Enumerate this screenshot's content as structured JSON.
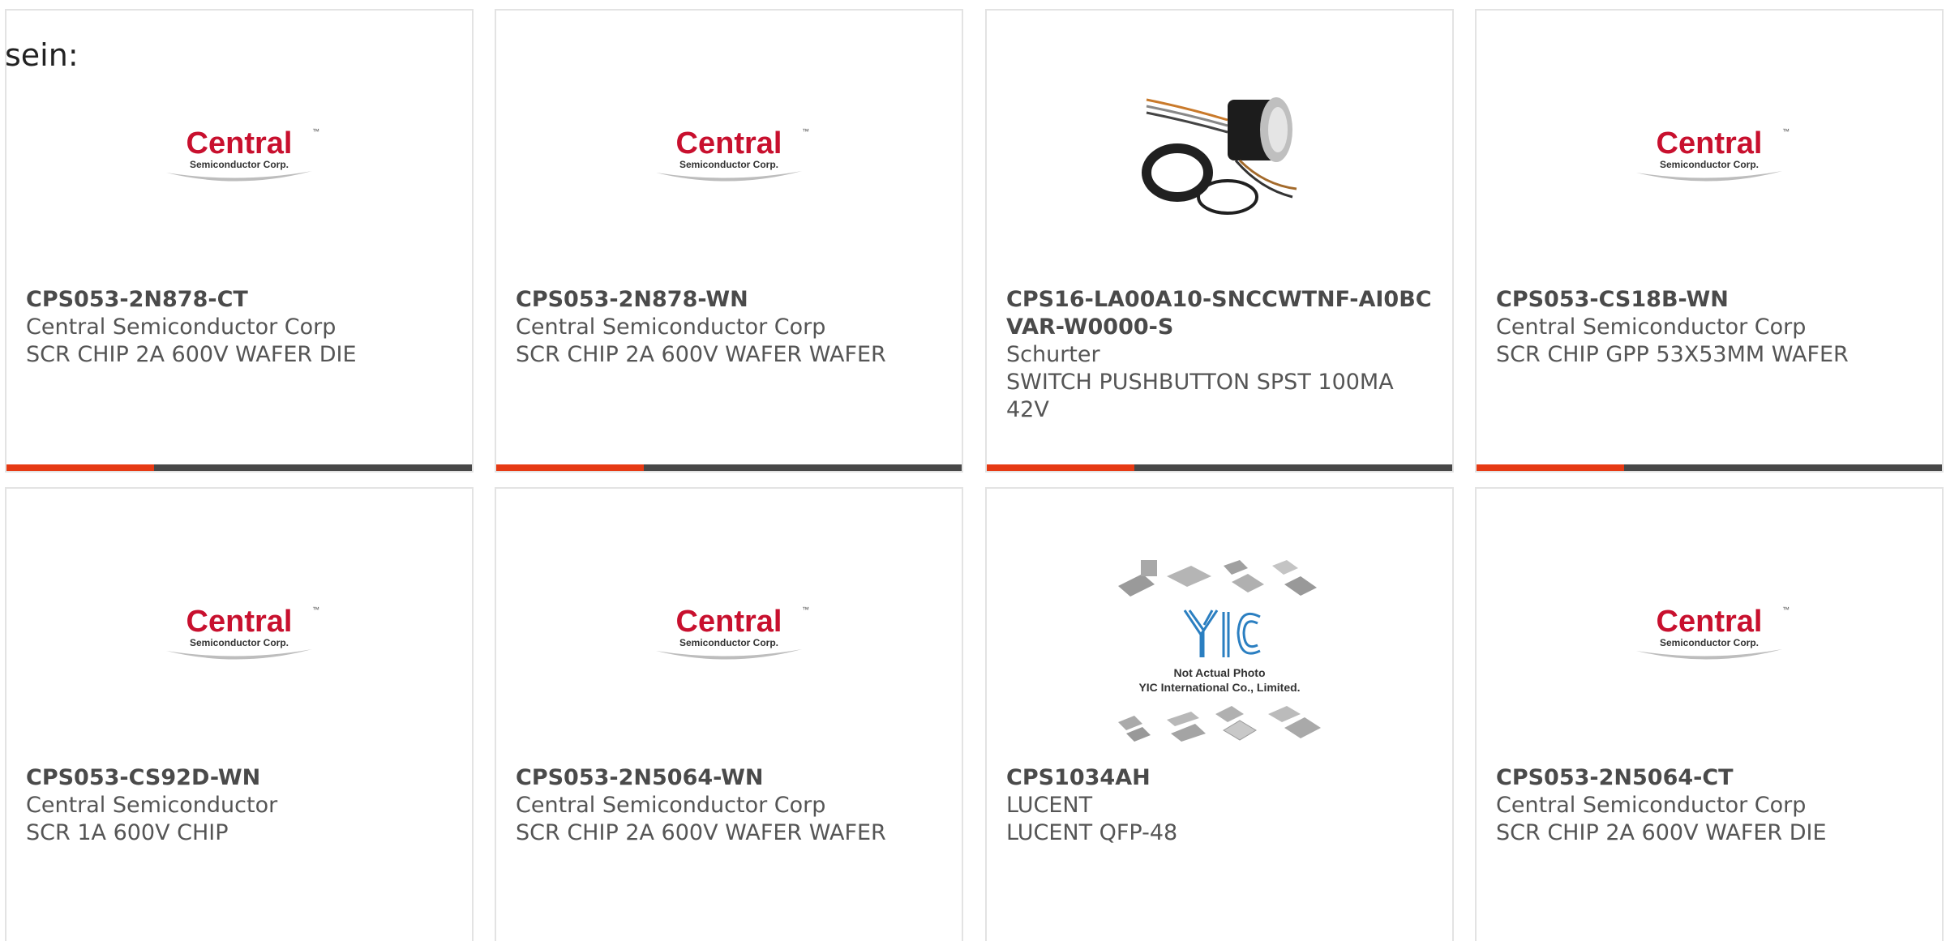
{
  "intro_text": "sein:",
  "colors": {
    "accent": "#e63a14",
    "bar_dark": "#474747",
    "logo_red": "#c8102e"
  },
  "products": [
    {
      "part_number": "CPS053-2N878-CT",
      "manufacturer": "Central Semiconductor Corp",
      "description": "SCR CHIP 2A 600V WAFER DIE",
      "image": "central-semiconductor-logo"
    },
    {
      "part_number": "CPS053-2N878-WN",
      "manufacturer": "Central Semiconductor Corp",
      "description": "SCR CHIP 2A 600V WAFER WAFER",
      "image": "central-semiconductor-logo"
    },
    {
      "part_number": "CPS16-LA00A10-SNCCWTNF-AI0BCVAR-W0000-S",
      "manufacturer": "Schurter",
      "description": "SWITCH PUSHBUTTON SPST 100MA 42V",
      "image": "pushbutton-switch-photo"
    },
    {
      "part_number": "CPS053-CS18B-WN",
      "manufacturer": "Central Semiconductor Corp",
      "description": "SCR CHIP GPP 53X53MM WAFER",
      "image": "central-semiconductor-logo"
    },
    {
      "part_number": "CPS053-CS92D-WN",
      "manufacturer": "Central Semiconductor",
      "description": "SCR 1A 600V CHIP",
      "image": "central-semiconductor-logo"
    },
    {
      "part_number": "CPS053-2N5064-WN",
      "manufacturer": "Central Semiconductor Corp",
      "description": "SCR CHIP 2A 600V WAFER WAFER",
      "image": "central-semiconductor-logo"
    },
    {
      "part_number": "CPS1034AH",
      "manufacturer": "LUCENT",
      "description": "LUCENT QFP-48",
      "image": "yic-not-actual-photo"
    },
    {
      "part_number": "CPS053-2N5064-CT",
      "manufacturer": "Central Semiconductor Corp",
      "description": "SCR CHIP 2A 600V WAFER DIE",
      "image": "central-semiconductor-logo"
    }
  ],
  "logo": {
    "central_word": "Central",
    "central_sub": "Semiconductor Corp.",
    "trademark": "™"
  },
  "yic": {
    "mark": "YIC",
    "caption_line1": "Not Actual Photo",
    "caption_line2": "YIC International Co., Limited."
  }
}
